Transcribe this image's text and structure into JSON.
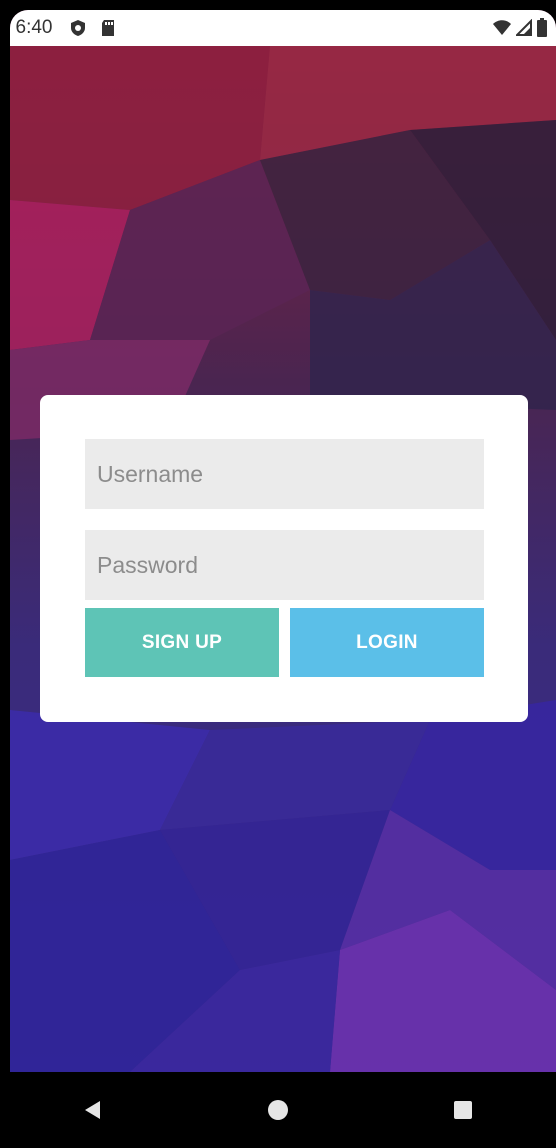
{
  "status_bar": {
    "time": "6:40",
    "icons": [
      "shield-icon",
      "sd-card-icon",
      "wifi-icon",
      "cell-signal-icon",
      "battery-icon"
    ]
  },
  "login_card": {
    "username_placeholder": "Username",
    "username_value": "",
    "password_placeholder": "Password",
    "password_value": "",
    "signup_label": "SIGN UP",
    "login_label": "LOGIN"
  },
  "colors": {
    "signup_button": "#5ec4b6",
    "login_button": "#5bbfe8",
    "field_background": "#ebebeb",
    "card_background": "#ffffff"
  },
  "nav_bar": {
    "icons": [
      "back-icon",
      "home-icon",
      "recents-icon"
    ]
  }
}
